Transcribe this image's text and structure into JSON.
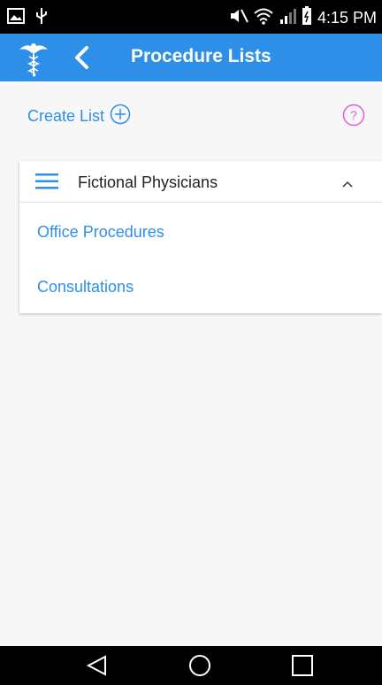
{
  "status": {
    "time": "4:15 PM",
    "icons": [
      "picture-icon",
      "usb-icon",
      "mute-icon",
      "wifi-icon",
      "signal-icon",
      "battery-icon"
    ]
  },
  "app_bar": {
    "title": "Procedure Lists",
    "logo": "caduceus-icon",
    "back": "chevron-left-icon",
    "color": "#2e8fe8"
  },
  "actions": {
    "create_label": "Create List",
    "help": "help-icon"
  },
  "group": {
    "title": "Fictional Physicians",
    "items": [
      {
        "label": "Office Procedures"
      },
      {
        "label": "Consultations"
      }
    ]
  },
  "nav": {
    "buttons": [
      "back-triangle-icon",
      "home-circle-icon",
      "recents-square-icon"
    ]
  }
}
